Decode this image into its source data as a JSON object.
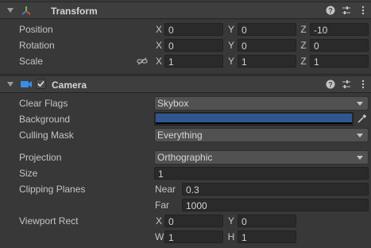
{
  "transform": {
    "title": "Transform",
    "position": {
      "label": "Position",
      "x": "0",
      "y": "0",
      "z": "-10"
    },
    "rotation": {
      "label": "Rotation",
      "x": "0",
      "y": "0",
      "z": "0"
    },
    "scale": {
      "label": "Scale",
      "x": "1",
      "y": "1",
      "z": "1"
    }
  },
  "axes": {
    "x": "X",
    "y": "Y",
    "z": "Z",
    "w": "W",
    "h": "H"
  },
  "camera": {
    "title": "Camera",
    "clear_flags": {
      "label": "Clear Flags",
      "value": "Skybox"
    },
    "background": {
      "label": "Background",
      "color": "#2f5690"
    },
    "culling_mask": {
      "label": "Culling Mask",
      "value": "Everything"
    },
    "projection": {
      "label": "Projection",
      "value": "Orthographic"
    },
    "size": {
      "label": "Size",
      "value": "1"
    },
    "clipping_planes": {
      "label": "Clipping Planes",
      "near_label": "Near",
      "near": "0.3",
      "far_label": "Far",
      "far": "1000"
    },
    "viewport_rect": {
      "label": "Viewport Rect",
      "x": "0",
      "y": "0",
      "w": "1",
      "h": "1"
    }
  }
}
